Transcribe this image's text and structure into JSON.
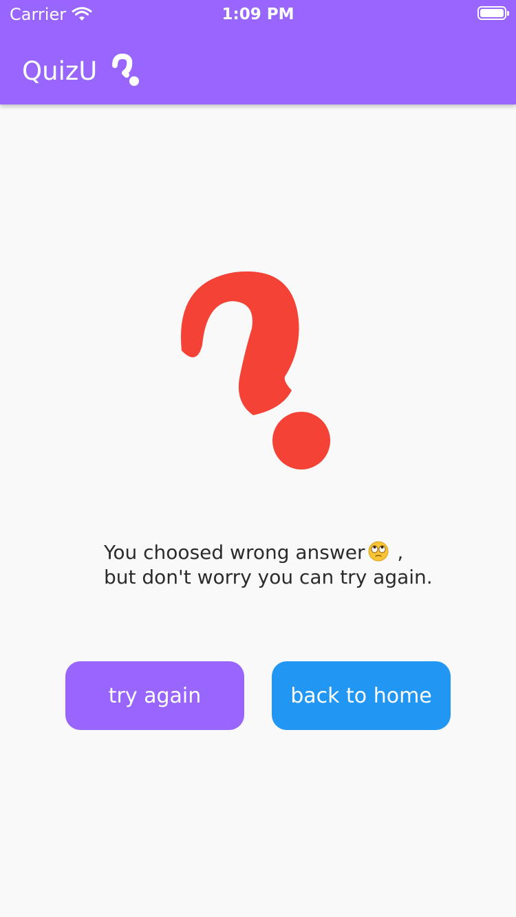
{
  "status_bar": {
    "carrier": "Carrier",
    "time": "1:09 PM",
    "icons": [
      "wifi-icon",
      "battery-icon"
    ]
  },
  "app_bar": {
    "title": "QuizU",
    "logo_icon": "question-mark-icon",
    "background_color": "#9866fd"
  },
  "result": {
    "hero_icon": "question-mark-icon",
    "hero_color": "#f44336",
    "message_line1": "You choosed wrong answer",
    "message_emoji": "face-with-rolling-eyes",
    "message_suffix": " ,",
    "message_line2": "but don't worry you can try again."
  },
  "actions": {
    "try_again_label": "try again",
    "try_again_color": "#9866fd",
    "back_home_label": "back to home",
    "back_home_color": "#2196f3"
  }
}
